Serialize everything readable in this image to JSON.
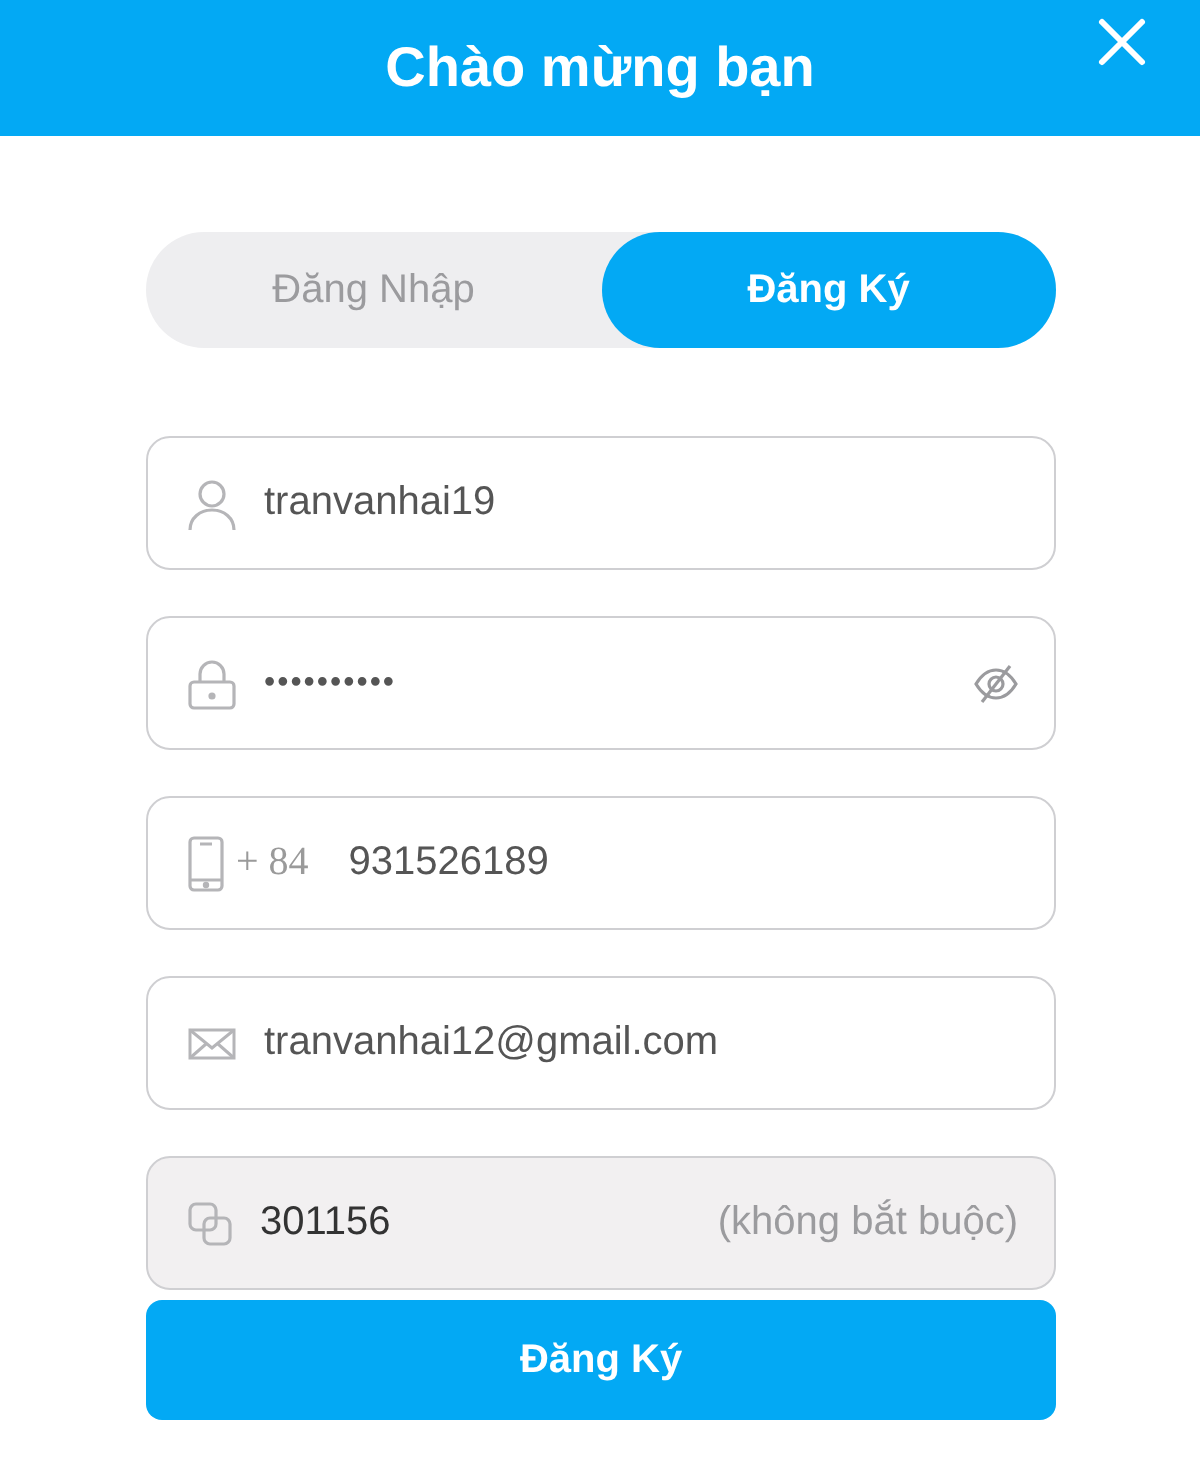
{
  "header": {
    "title": "Chào mừng bạn"
  },
  "tabs": [
    {
      "label": "Đăng Nhập",
      "selected": false
    },
    {
      "label": "Đăng Ký",
      "selected": true
    }
  ],
  "fields": [
    {
      "kind": "user",
      "value": "tranvanhai19"
    },
    {
      "kind": "password",
      "value": "••••••••••"
    },
    {
      "kind": "phone",
      "prefix": "+ 84",
      "value": "931526189"
    },
    {
      "kind": "email",
      "value": "tranvanhai12@gmail.com"
    },
    {
      "kind": "referral",
      "value": "301156",
      "note": "(không bắt buộc)",
      "disabled": true
    }
  ],
  "submit": {
    "label": "Đăng Ký"
  }
}
